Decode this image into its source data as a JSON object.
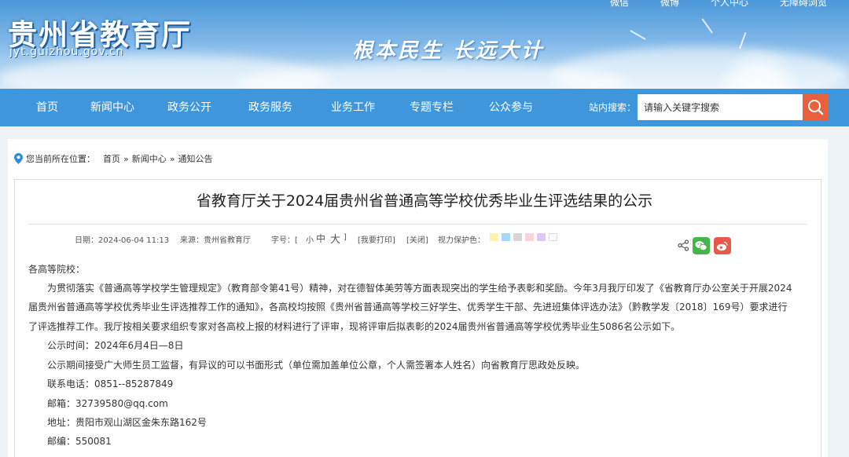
{
  "header": {
    "site_title": "贵州省教育厅",
    "site_domain": "jyt.guizhou.gov.cn",
    "slogan": "根本民生 长远大计",
    "top_links": [
      "微信",
      "微博",
      "个人中心",
      "无障碍浏览"
    ]
  },
  "nav": {
    "items": [
      "首页",
      "新闻中心",
      "政务公开",
      "政务服务",
      "业务工作",
      "专题专栏",
      "公众参与"
    ],
    "search_label": "站内搜索：",
    "search_placeholder": "请输入关键字搜索",
    "search_icon": "search-icon"
  },
  "breadcrumb": {
    "prefix": "您当前所在位置：",
    "items": [
      "首页",
      "»",
      "新闻中心",
      "»",
      "通知公告"
    ]
  },
  "article": {
    "title": "省教育厅关于2024届贵州省普通高等学校优秀毕业生评选结果的公示",
    "meta": {
      "date": "日期：2024-06-04 11:13",
      "source": "来源：贵州省教育厅",
      "font_label": "字号：[",
      "font_small": "小",
      "font_medium": "中",
      "font_large": "大",
      "font_close": "]",
      "print": "[我要打印]",
      "close": "[关闭]",
      "eye_label": "视力保护色：",
      "eye_colors": [
        "#fffacd",
        "#b0e2ff",
        "#d3d3d3",
        "#ffe4e1",
        "#e6ccff",
        "#ffffff"
      ]
    },
    "greeting": "各高等院校：",
    "paragraph_lines": [
      "为贯彻落实《普通高等学校学生管理规定》（教育部令第41号）精神，对在德智体美劳等方面表现突出的学生给予表彰和奖励。今年3月我厅印发了《省教育厅办公室关于开展2024",
      "届贵州省普通高等学校优秀毕业生评选推荐工作的通知》，各高校均按照《贵州省普通高等学校三好学生、优秀学生干部、先进班集体评选办法》（黔教学发〔2018〕169号）要求进行",
      "了评选推荐工作。我厅按相关要求组织专家对各高校上报的材料进行了评审，现将评审后拟表彰的2024届贵州省普通高等学校优秀毕业生5086名公示如下。"
    ],
    "details": [
      "公示时间：2024年6月4日—8日",
      "公示期间接受广大师生员工监督，有异议的可以书面形式（单位需加盖单位公章，个人需签署本人姓名）向省教育厅思政处反映。",
      "联系电话：0851--85287849",
      "邮箱：32739580@qq.com",
      "地址：贵阳市观山湖区金朱东路162号",
      "邮编：550081"
    ]
  }
}
